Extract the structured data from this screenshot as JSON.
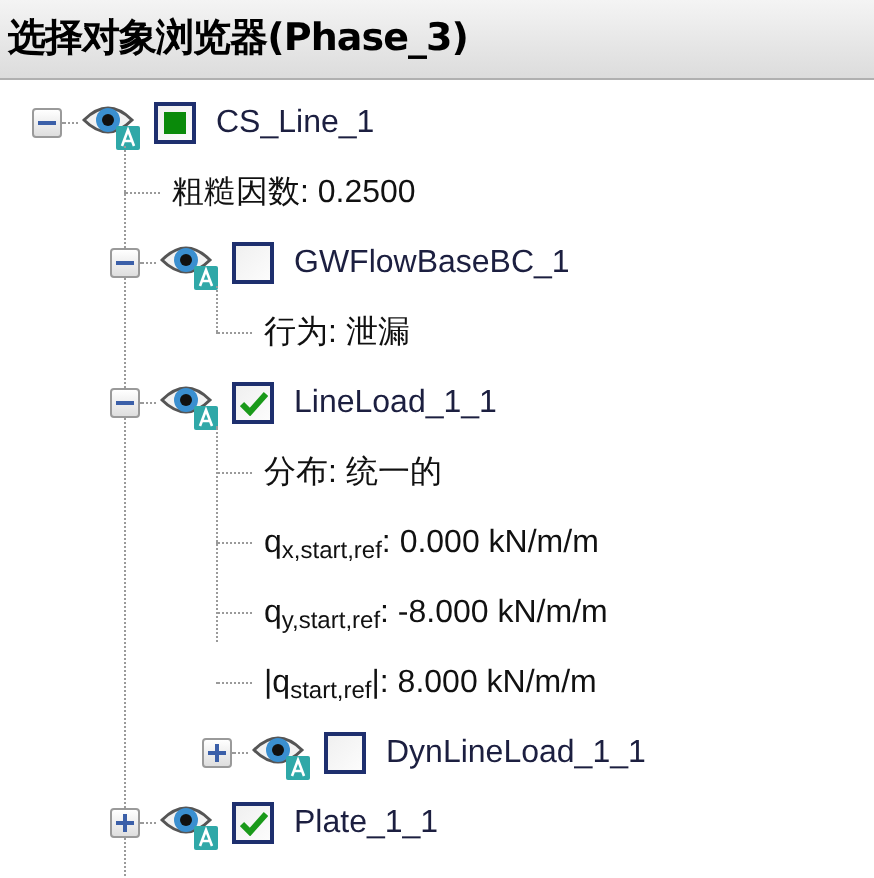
{
  "window": {
    "title": "选择对象浏览器(Phase_3)"
  },
  "tree": [
    {
      "kind": "object",
      "label": "CS_Line_1",
      "expanded": true,
      "mixed": true,
      "children": [
        {
          "kind": "property",
          "text": "粗糙因数: 0.2500"
        },
        {
          "kind": "object",
          "label": "GWFlowBaseBC_1",
          "expanded": true,
          "checked": false,
          "children": [
            {
              "kind": "property",
              "text": "行为: 泄漏"
            }
          ]
        },
        {
          "kind": "object",
          "label": "LineLoad_1_1",
          "expanded": true,
          "checked": true,
          "children": [
            {
              "kind": "property",
              "text": "分布: 统一的"
            },
            {
              "kind": "property",
              "text": "q$_{x,start,ref}$: 0.000 kN/m/m"
            },
            {
              "kind": "property",
              "text": "q$_{y,start,ref}$: -8.000 kN/m/m"
            },
            {
              "kind": "property",
              "text": "|q$_{start,ref}$|: 8.000 kN/m/m"
            },
            {
              "kind": "object",
              "label": "DynLineLoad_1_1",
              "expanded": false,
              "checked": false
            }
          ]
        },
        {
          "kind": "object",
          "label": "Plate_1_1",
          "expanded": false,
          "checked": true
        }
      ]
    }
  ]
}
